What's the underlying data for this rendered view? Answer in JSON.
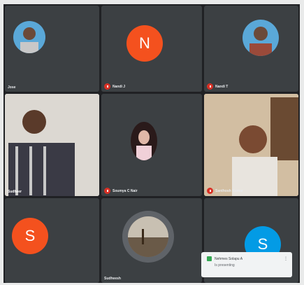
{
  "participants": [
    {
      "name": "Jose",
      "avatar": "photo-man-1",
      "muted": true
    },
    {
      "name": "Nandi J",
      "avatar_letter": "N",
      "avatar_color": "#f4511e",
      "muted": true
    },
    {
      "name": "Nandi T",
      "avatar": "photo-man-2",
      "muted": true
    },
    {
      "name": "Sudheer",
      "video": true,
      "muted": false
    },
    {
      "name": "Soumya C Nair",
      "avatar": "photo-woman",
      "muted": true
    },
    {
      "name": "Santhosh Kumar",
      "video": true,
      "muted": true
    },
    {
      "name": "",
      "avatar_letter": "S",
      "avatar_color": "#f4511e",
      "muted": false
    },
    {
      "name": "Sudheesh",
      "avatar": "photo-landscape",
      "muted": false,
      "speaking": true
    },
    {
      "name": "",
      "avatar_letter": "S",
      "avatar_color": "#039be5",
      "muted": false
    }
  ],
  "toast": {
    "title": "Nehmes Solapu A",
    "subtitle": "Is presenting",
    "icon": "present-icon",
    "menu": "⋮"
  },
  "colors": {
    "background": "#202124",
    "tile": "#3c4043",
    "muted": "#d93025"
  }
}
